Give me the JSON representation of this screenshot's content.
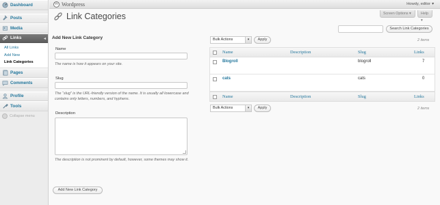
{
  "sidebar": {
    "menu": [
      {
        "label": "Dashboard"
      },
      {
        "label": "Posts"
      },
      {
        "label": "Media"
      },
      {
        "label": "Links"
      },
      {
        "label": "Pages"
      },
      {
        "label": "Comments"
      },
      {
        "label": "Profile"
      },
      {
        "label": "Tools"
      }
    ],
    "links_submenu": [
      "All Links",
      "Add New",
      "Link Categories"
    ],
    "collapse_label": "Collapse menu"
  },
  "header": {
    "site_title": "Wordpress",
    "howdy": "Howdy, editor"
  },
  "screen_options_label": "Screen Options",
  "help_label": "Help",
  "page_title": "Link Categories",
  "search": {
    "button_label": "Search Link Categories",
    "value": ""
  },
  "form": {
    "heading": "Add New Link Category",
    "name_label": "Name",
    "name_desc": "The name is how it appears on your site.",
    "slug_label": "Slug",
    "slug_desc": "The “slug” is the URL-friendly version of the name. It is usually all lowercase and contains only letters, numbers, and hyphens.",
    "description_label": "Description",
    "description_desc": "The description is not prominent by default, however, some themes may show it.",
    "submit_label": "Add New Link Category"
  },
  "list": {
    "bulk_actions": "Bulk Actions",
    "apply_label": "Apply",
    "items_count": "2 items",
    "columns": [
      "Name",
      "Description",
      "Slug",
      "Links"
    ],
    "rows": [
      {
        "name": "Blogroll",
        "description": "",
        "slug": "blogroll",
        "links": "7"
      },
      {
        "name": "cats",
        "description": "",
        "slug": "cats",
        "links": "0"
      }
    ]
  },
  "colors": {
    "link": "#21759b",
    "active_menu": "#6d6d6d",
    "sidebar_bg": "#ececec"
  }
}
